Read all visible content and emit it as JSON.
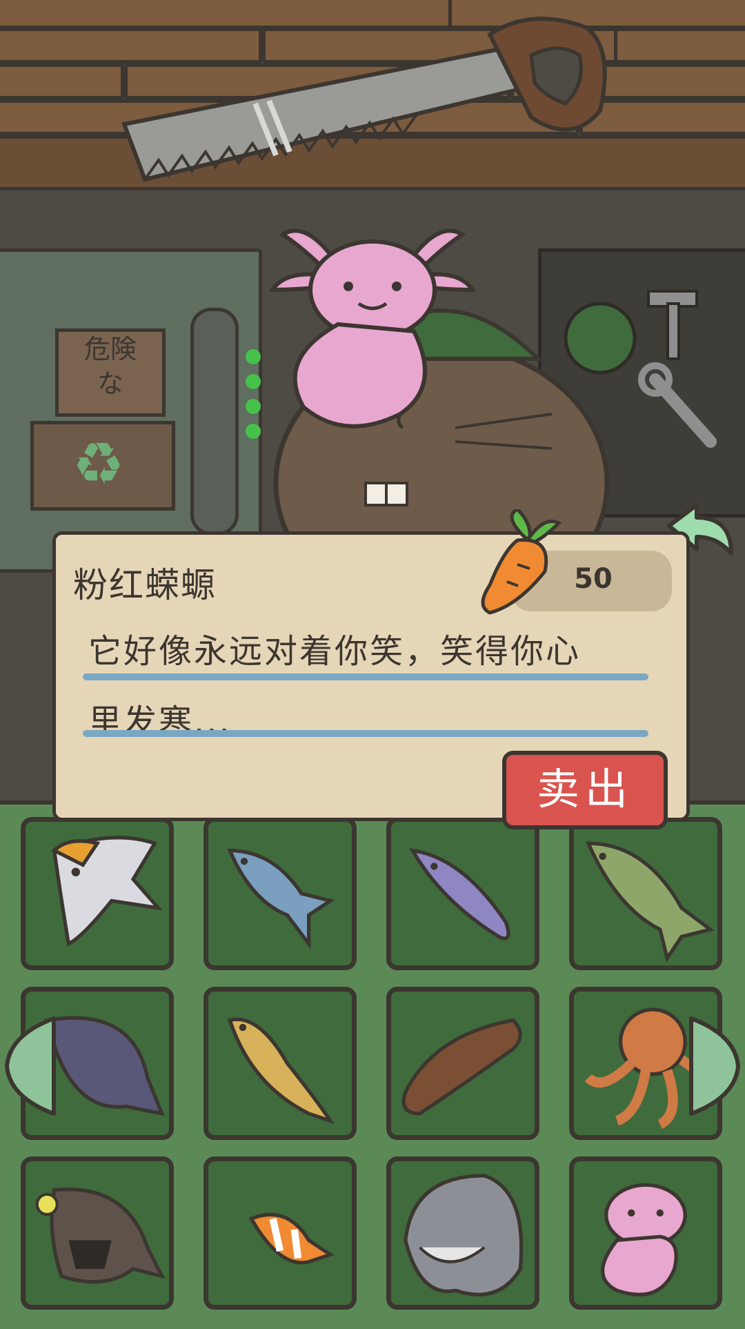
{
  "item": {
    "name": "粉红蝾螈",
    "price": "50",
    "price_icon": "carrot-icon",
    "description_line1": "它好像永远对着你笑，笑得你心",
    "description_line2": "里发寒..."
  },
  "buttons": {
    "sell_label": "卖出",
    "back_icon": "back-arrow-icon",
    "prev_icon": "left-arrow-icon",
    "next_icon": "right-arrow-icon"
  },
  "scene": {
    "sign_text_line1": "危険",
    "sign_text_line2": "な"
  },
  "inventory": [
    {
      "icon": "angelfish-icon"
    },
    {
      "icon": "blue-fish-icon"
    },
    {
      "icon": "needlefish-icon"
    },
    {
      "icon": "green-bass-icon"
    },
    {
      "icon": "flounder-icon"
    },
    {
      "icon": "goby-icon"
    },
    {
      "icon": "sea-cucumber-icon"
    },
    {
      "icon": "octopus-icon"
    },
    {
      "icon": "anglerfish-icon"
    },
    {
      "icon": "clownfish-icon"
    },
    {
      "icon": "shark-icon"
    },
    {
      "icon": "axolotl-icon"
    }
  ],
  "colors": {
    "panel": "#e6d6b8",
    "sell_button": "#d9534f",
    "grid_bg": "#5b8a57",
    "slot_bg": "#3f6b3d",
    "underline": "#7aa7c4"
  }
}
